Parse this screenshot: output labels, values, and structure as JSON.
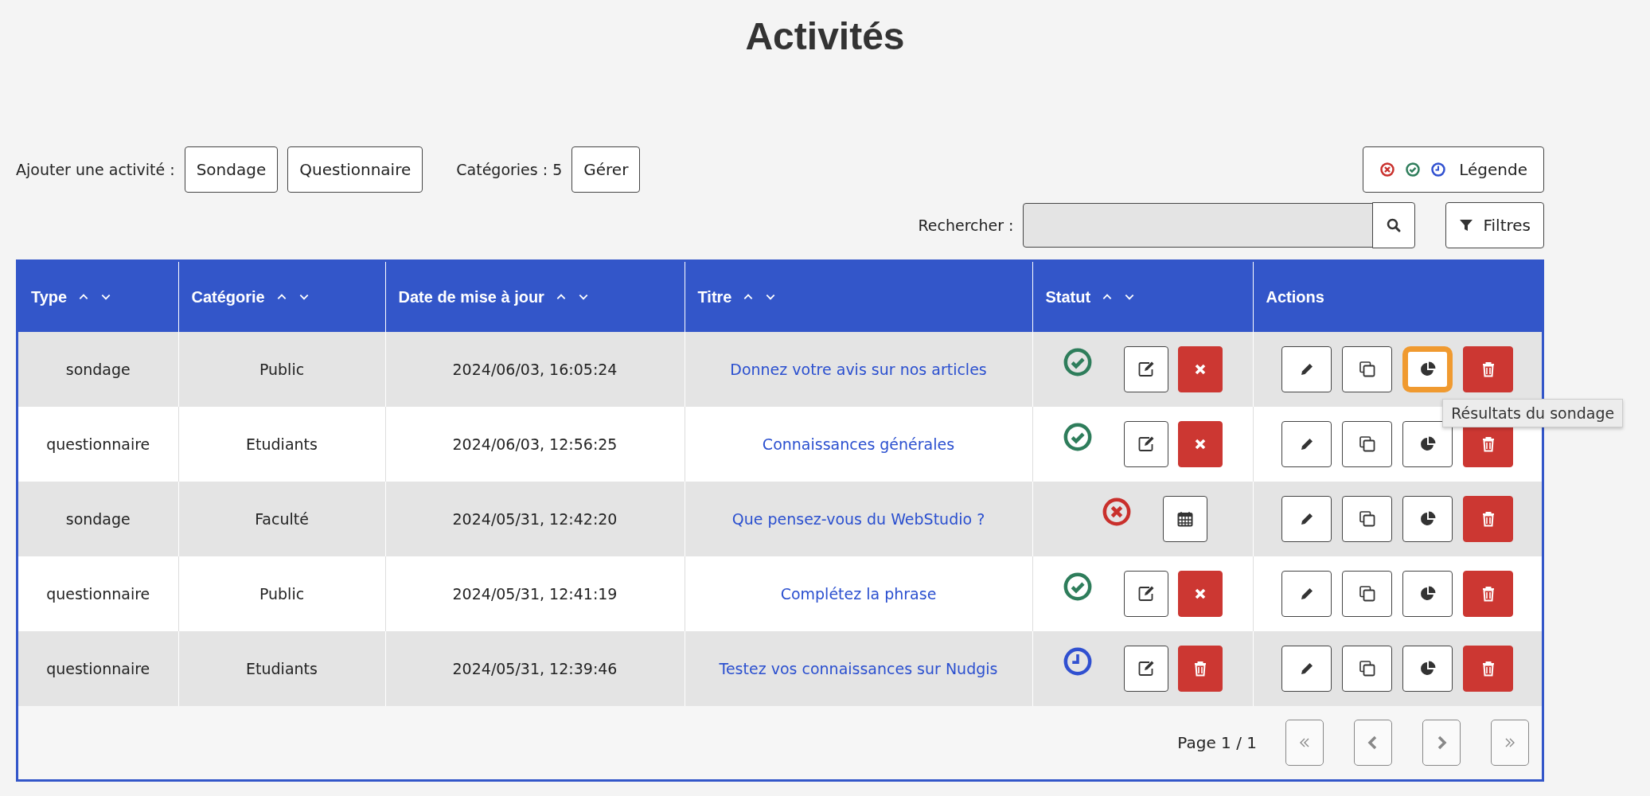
{
  "title": "Activités",
  "toolbar": {
    "add_label": "Ajouter une activité :",
    "add_buttons": [
      "Sondage",
      "Questionnaire"
    ],
    "categories_label": "Catégories : 5",
    "manage_button": "Gérer",
    "legend_button": {
      "label": "Légende",
      "icons": [
        {
          "kind": "inactive"
        },
        {
          "kind": "active"
        },
        {
          "kind": "scheduled"
        }
      ]
    },
    "search_label": "Rechercher :",
    "filters_button": "Filtres"
  },
  "table": {
    "columns": [
      {
        "label": "Type",
        "sortable": true
      },
      {
        "label": "Catégorie",
        "sortable": true
      },
      {
        "label": "Date de mise à jour",
        "sortable": true
      },
      {
        "label": "Titre",
        "sortable": true
      },
      {
        "label": "Statut",
        "sortable": true
      },
      {
        "label": "Actions",
        "sortable": false
      }
    ],
    "rows": [
      {
        "type": "sondage",
        "category": "Public",
        "date": "2024/06/03, 16:05:24",
        "title": "Donnez votre avis sur nos articles",
        "status": {
          "kind": "active"
        },
        "status_buttons": [
          {
            "kind": "edit"
          },
          {
            "kind": "cancel"
          }
        ],
        "actions": [
          {
            "kind": "edit",
            "highlighted": false
          },
          {
            "kind": "copy",
            "highlighted": false
          },
          {
            "kind": "results",
            "highlighted": true,
            "tooltip": "Résultats du sondage"
          },
          {
            "kind": "delete",
            "highlighted": false
          }
        ]
      },
      {
        "type": "questionnaire",
        "category": "Etudiants",
        "date": "2024/06/03, 12:56:25",
        "title": "Connaissances générales",
        "status": {
          "kind": "active"
        },
        "status_buttons": [
          {
            "kind": "edit"
          },
          {
            "kind": "cancel"
          }
        ],
        "actions": [
          {
            "kind": "edit",
            "highlighted": false
          },
          {
            "kind": "copy",
            "highlighted": false
          },
          {
            "kind": "results",
            "highlighted": false
          },
          {
            "kind": "delete",
            "highlighted": false
          }
        ]
      },
      {
        "type": "sondage",
        "category": "Faculté",
        "date": "2024/05/31, 12:42:20",
        "title": "Que pensez-vous du WebStudio ?",
        "status": {
          "kind": "inactive"
        },
        "status_buttons": [
          {
            "kind": "schedule"
          }
        ],
        "actions": [
          {
            "kind": "edit",
            "highlighted": false
          },
          {
            "kind": "copy",
            "highlighted": false
          },
          {
            "kind": "results",
            "highlighted": false
          },
          {
            "kind": "delete",
            "highlighted": false
          }
        ]
      },
      {
        "type": "questionnaire",
        "category": "Public",
        "date": "2024/05/31, 12:41:19",
        "title": "Complétez la phrase",
        "status": {
          "kind": "active"
        },
        "status_buttons": [
          {
            "kind": "edit"
          },
          {
            "kind": "cancel"
          }
        ],
        "actions": [
          {
            "kind": "edit",
            "highlighted": false
          },
          {
            "kind": "copy",
            "highlighted": false
          },
          {
            "kind": "results",
            "highlighted": false
          },
          {
            "kind": "delete",
            "highlighted": false
          }
        ]
      },
      {
        "type": "questionnaire",
        "category": "Etudiants",
        "date": "2024/05/31, 12:39:46",
        "title": "Testez vos connaissances sur Nudgis",
        "status": {
          "kind": "scheduled"
        },
        "status_buttons": [
          {
            "kind": "edit"
          },
          {
            "kind": "delete"
          }
        ],
        "actions": [
          {
            "kind": "edit",
            "highlighted": false
          },
          {
            "kind": "copy",
            "highlighted": false
          },
          {
            "kind": "results",
            "highlighted": false
          },
          {
            "kind": "delete",
            "highlighted": false
          }
        ]
      }
    ],
    "pagination": {
      "label": "Page 1 / 1",
      "buttons": [
        {
          "kind": "first"
        },
        {
          "kind": "previous"
        },
        {
          "kind": "next"
        },
        {
          "kind": "last"
        }
      ]
    }
  }
}
